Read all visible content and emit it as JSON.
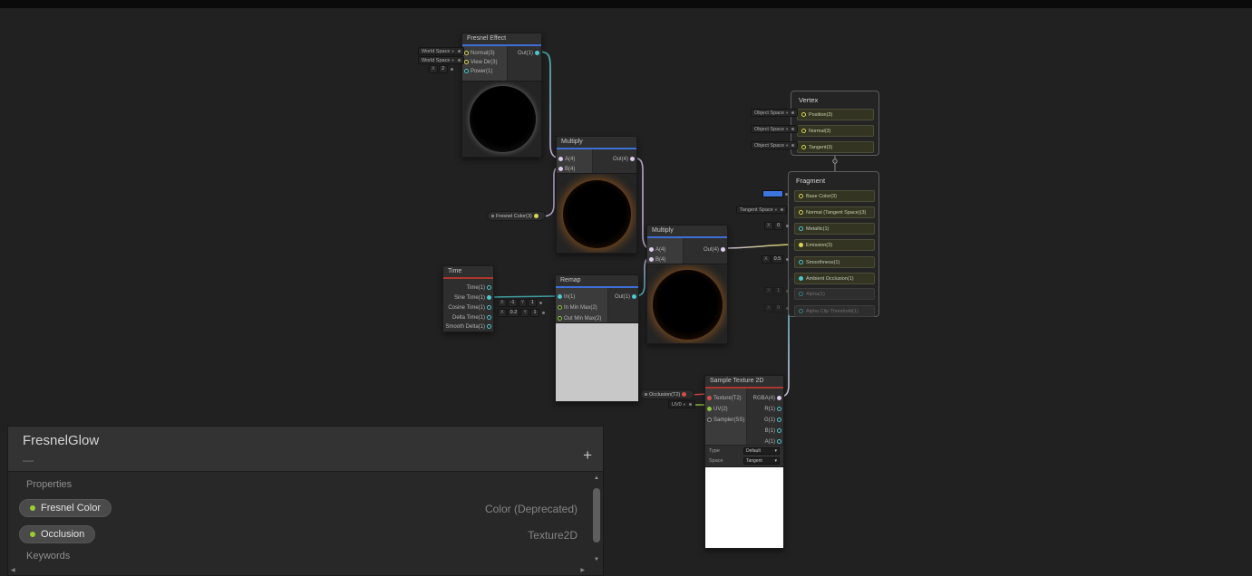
{
  "colors": {
    "canvas_bg": "#212121",
    "node_bg": "#2F2F2F",
    "category_math_blue": "#3D6FD8",
    "category_input_red": "#AD372C",
    "port_float": "#4FC7CE",
    "port_vector2": "#8CC63F",
    "port_vector3": "#D9D655",
    "port_vector4": "#DECDEE",
    "port_texture2d": "#D44E4E",
    "base_color_swatch": "#3D76DD",
    "fresnel_glow_orange": "#E67E22",
    "property_dot_green": "#9ACD32"
  },
  "icons": {
    "dropdown_arrow": "▾",
    "scroll_up": "▲",
    "scroll_down": "▼",
    "scroll_left": "◀",
    "scroll_right": "▶"
  },
  "nodes": {
    "fresnel_effect": {
      "title": "Fresnel Effect",
      "inputs": [
        "Normal(3)",
        "View Dir(3)",
        "Power(1)"
      ],
      "output": "Out(1)",
      "normal_space": "World Space",
      "viewdir_space": "World Space",
      "power_field": {
        "label": "X",
        "value": "2"
      }
    },
    "multiply1": {
      "title": "Multiply",
      "input_a": "A(4)",
      "input_b": "B(4)",
      "output": "Out(4)"
    },
    "multiply2": {
      "title": "Multiply",
      "input_a": "A(4)",
      "input_b": "B(4)",
      "output": "Out(4)"
    },
    "time": {
      "title": "Time",
      "outputs": [
        "Time(1)",
        "Sine Time(1)",
        "Cosine Time(1)",
        "Delta Time(1)",
        "Smooth Delta(1)"
      ]
    },
    "remap": {
      "title": "Remap",
      "inputs": [
        "In(1)",
        "In Min Max(2)",
        "Out Min Max(2)"
      ],
      "output": "Out(1)",
      "in_min_max": {
        "x_label": "X",
        "x_value": "-1",
        "y_label": "Y",
        "y_value": "1"
      },
      "out_min_max": {
        "x_label": "X",
        "x_value": "0.2",
        "y_label": "Y",
        "y_value": "1"
      }
    },
    "vertex": {
      "title": "Vertex",
      "blocks": [
        "Position(3)",
        "Normal(3)",
        "Tangent(3)"
      ],
      "spaces": [
        "Object Space",
        "Object Space",
        "Object Space"
      ]
    },
    "fragment": {
      "title": "Fragment",
      "blocks": [
        "Base Color(3)",
        "Normal (Tangent Space)(3)",
        "Metallic(1)",
        "Emission(3)",
        "Smoothness(1)",
        "Ambient Occlusion(1)",
        "Alpha(1)",
        "Alpha Clip Threshold(1)"
      ],
      "normal_space": "Tangent Space",
      "metallic_field": {
        "label": "X",
        "value": "0"
      },
      "smoothness_field": {
        "label": "X",
        "value": "0.5"
      },
      "alpha_field": {
        "label": "X",
        "value": "1"
      },
      "alpha_clip_field": {
        "label": "X",
        "value": "0"
      }
    },
    "sample_texture_2d": {
      "title": "Sample Texture 2D",
      "inputs": [
        "Texture(T2)",
        "UV(2)",
        "Sampler(SS)"
      ],
      "outputs": [
        "RGBA(4)",
        "R(1)",
        "G(1)",
        "B(1)",
        "A(1)"
      ],
      "type_label": "Type",
      "type_value": "Default",
      "space_label": "Space",
      "space_value": "Tangent"
    },
    "fresnel_color_property": {
      "label": "Fresnel Color(3)"
    },
    "occlusion_property": {
      "label": "Occlusion(T2)"
    },
    "uv_channel": {
      "label": "UV0"
    }
  },
  "blackboard": {
    "title": "FresnelGlow",
    "subtitle": "—",
    "add_button": "+",
    "properties_section": "Properties",
    "keywords_section": "Keywords",
    "properties": [
      {
        "name": "Fresnel Color",
        "type": "Color (Deprecated)"
      },
      {
        "name": "Occlusion",
        "type": "Texture2D"
      }
    ]
  }
}
